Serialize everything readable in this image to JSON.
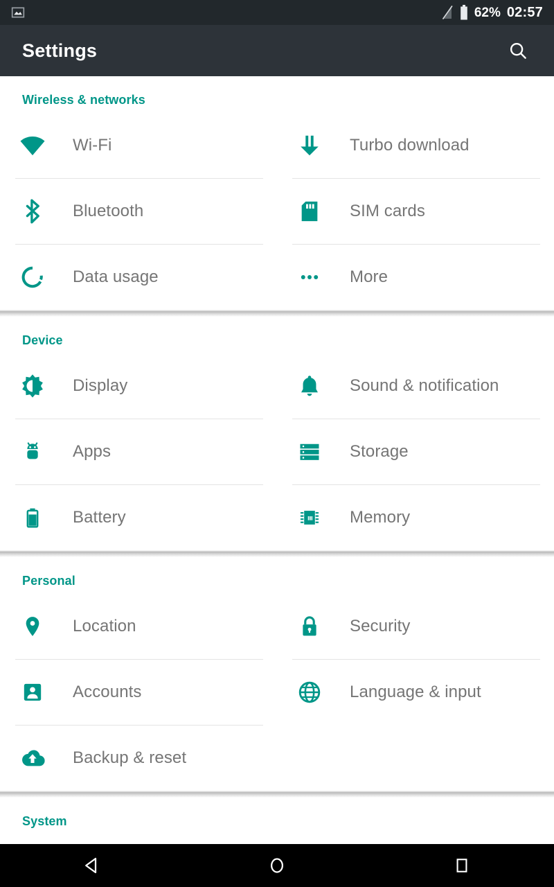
{
  "status_bar": {
    "notification_icon": "screenshot-image-icon",
    "signal_icon": "no-sim-signal-icon",
    "battery_icon": "battery-icon",
    "battery_percent": "62%",
    "clock": "02:57"
  },
  "app_bar": {
    "title": "Settings",
    "search_icon": "search-icon"
  },
  "colors": {
    "accent_teal": "#009688",
    "app_bar_bg": "#2d3339",
    "status_bar_bg": "#22282c",
    "label_text": "#757575",
    "divider": "#e4e4e4",
    "nav_bar_bg": "#000000"
  },
  "sections": [
    {
      "title": "Wireless & networks",
      "items": [
        {
          "label": "Wi-Fi",
          "icon": "wifi-icon",
          "column": "left",
          "divider": false
        },
        {
          "label": "Turbo download",
          "icon": "download-arrow-icon",
          "column": "right",
          "divider": false
        },
        {
          "label": "Bluetooth",
          "icon": "bluetooth-icon",
          "column": "left",
          "divider": true
        },
        {
          "label": "SIM cards",
          "icon": "sim-card-icon",
          "column": "right",
          "divider": true
        },
        {
          "label": "Data usage",
          "icon": "data-usage-icon",
          "column": "left",
          "divider": true
        },
        {
          "label": "More",
          "icon": "more-dots-icon",
          "column": "right",
          "divider": true
        }
      ]
    },
    {
      "title": "Device",
      "items": [
        {
          "label": "Display",
          "icon": "brightness-icon",
          "column": "left",
          "divider": false
        },
        {
          "label": "Sound & notification",
          "icon": "bell-icon",
          "column": "right",
          "divider": false
        },
        {
          "label": "Apps",
          "icon": "android-icon",
          "column": "left",
          "divider": true
        },
        {
          "label": "Storage",
          "icon": "storage-icon",
          "column": "right",
          "divider": true
        },
        {
          "label": "Battery",
          "icon": "battery-icon",
          "column": "left",
          "divider": true
        },
        {
          "label": "Memory",
          "icon": "memory-chip-icon",
          "column": "right",
          "divider": true
        }
      ]
    },
    {
      "title": "Personal",
      "items": [
        {
          "label": "Location",
          "icon": "location-pin-icon",
          "column": "left",
          "divider": false
        },
        {
          "label": "Security",
          "icon": "lock-icon",
          "column": "right",
          "divider": false
        },
        {
          "label": "Accounts",
          "icon": "account-box-icon",
          "column": "left",
          "divider": true
        },
        {
          "label": "Language & input",
          "icon": "globe-icon",
          "column": "right",
          "divider": true
        },
        {
          "label": "Backup & reset",
          "icon": "cloud-upload-icon",
          "column": "left",
          "divider": true
        }
      ]
    },
    {
      "title": "System",
      "items": []
    }
  ],
  "nav_bar": {
    "back": "back-triangle-icon",
    "home": "home-circle-icon",
    "recents": "recents-square-icon"
  }
}
